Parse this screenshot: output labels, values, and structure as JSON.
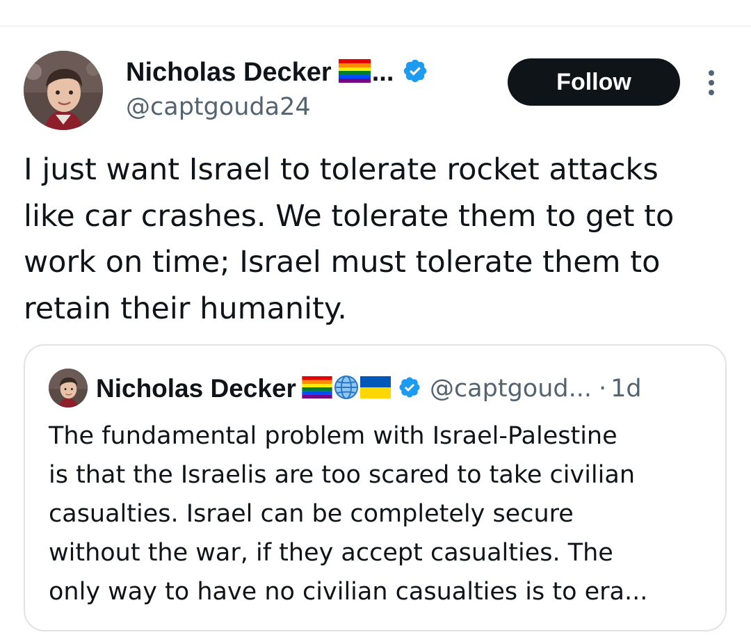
{
  "tweet": {
    "author": {
      "display_name": "Nicholas Decker",
      "name_truncation": "...",
      "handle": "@captgouda24",
      "verified": true,
      "avatar_icon": "profile-photo",
      "name_emoji": [
        "rainbow-flag"
      ]
    },
    "follow_label": "Follow",
    "more_icon": "more-vertical-icon",
    "text_lines": [
      "I just want Israel to tolerate rocket attacks",
      "like car crashes. We tolerate them to get to",
      "work on time; Israel must tolerate them to",
      "retain their humanity."
    ]
  },
  "quote": {
    "author": {
      "display_name": "Nicholas Decker",
      "handle": "@captgoud...",
      "verified": true,
      "avatar_icon": "profile-photo",
      "name_emoji": [
        "rainbow-flag",
        "globe",
        "ukraine-flag"
      ]
    },
    "separator": "·",
    "time": "1d",
    "text_lines": [
      "The fundamental problem with Israel-Palestine",
      "is that the Israelis are too scared to take civilian",
      "casualties. Israel can be completely secure",
      "without the war, if they accept casualties. The",
      "only way to have no civilian casualties is to era..."
    ]
  },
  "colors": {
    "text": "#0f1419",
    "secondary": "#536471",
    "verified_blue": "#1d9bf0",
    "follow_bg": "#0f1419",
    "follow_text": "#ffffff",
    "border": "#dfe3e6"
  }
}
